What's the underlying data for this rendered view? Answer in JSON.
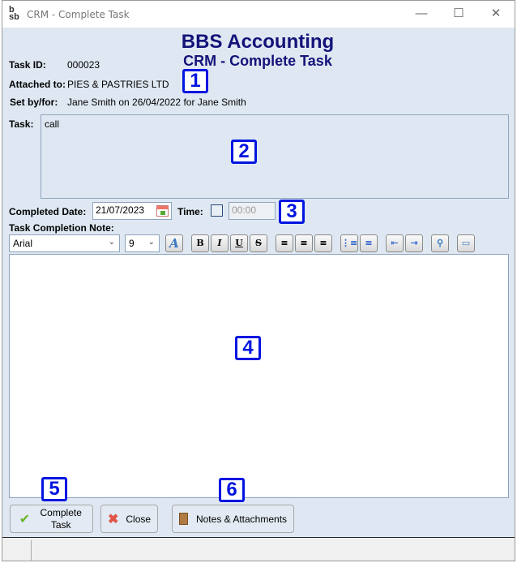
{
  "window": {
    "title": "CRM - Complete Task",
    "icon": "bsb-logo-icon"
  },
  "header": {
    "company": "BBS Accounting",
    "title": "CRM - Complete Task"
  },
  "task": {
    "id_label": "Task ID:",
    "id": "000023",
    "attached_label": "Attached to:",
    "attached": "PIES & PASTRIES LTD",
    "setby_label": "Set by/for:",
    "setby": "Jane Smith on 26/04/2022 for Jane Smith",
    "task_label": "Task:",
    "task_text": "call"
  },
  "completion": {
    "date_label": "Completed Date:",
    "date": "21/07/2023",
    "time_label": "Time:",
    "time_checked": false,
    "time": "00:00",
    "note_label": "Task Completion Note:"
  },
  "toolbar": {
    "font": "Arial",
    "size": "9",
    "bold": "B",
    "italic": "I",
    "underline": "U",
    "strike": "S",
    "font_color": "A"
  },
  "buttons": {
    "complete": "Complete Task",
    "close": "Close",
    "notes": "Notes & Attachments"
  },
  "badges": [
    "1",
    "2",
    "3",
    "4",
    "5",
    "6"
  ],
  "colors": {
    "title": "#13137a",
    "badge": "#0015e0",
    "background": "#dfe8f2"
  }
}
